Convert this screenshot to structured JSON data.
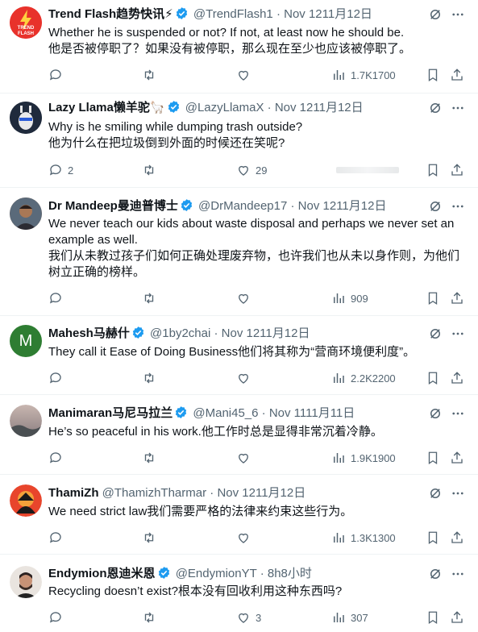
{
  "colors": {
    "text": "#0f1419",
    "muted": "#536471",
    "verified": "#1d9bf0",
    "border": "#eff3f4"
  },
  "tweets": [
    {
      "name": "Trend Flash趋势快讯⚡",
      "handle": "@TrendFlash1",
      "sep": "·",
      "time": "Nov 1211月12日",
      "lines": [
        "Whether he is suspended or not? If not, at least now he should be.",
        "他是否被停职了？如果没有被停职，那么现在至少也应该被停职了。"
      ],
      "replies": "",
      "retweets": "",
      "likes": "",
      "views": "1.7K1700",
      "avatar_label": "TREND FLASH"
    },
    {
      "name": "Lazy Llama懒羊驼🦙",
      "handle": "@LazyLlamaX",
      "sep": "·",
      "time": "Nov 1211月12日",
      "lines": [
        "Why is he smiling while dumping trash outside?",
        "他为什么在把垃圾倒到外面的时候还在笑呢?"
      ],
      "replies": "2",
      "retweets": "",
      "likes": "29",
      "views": ""
    },
    {
      "name": "Dr Mandeep曼迪普博士",
      "handle": "@DrMandeep17",
      "sep": "·",
      "time": "Nov 1211月12日",
      "lines": [
        "We never teach our kids about waste disposal and perhaps we never set an",
        "example as well.",
        "我们从未教过孩子们如何正确处理废弃物，也许我们也从未以身作则，为他们",
        "树立正确的榜样。"
      ],
      "replies": "",
      "retweets": "",
      "likes": "",
      "views": "909"
    },
    {
      "name": "Mahesh马赫什",
      "handle": "@1by2chai",
      "sep": "·",
      "time": "Nov 1211月12日",
      "lines": [
        "They call it Ease of Doing Business他们将其称为“营商环境便利度”。"
      ],
      "replies": "",
      "retweets": "",
      "likes": "",
      "views": "2.2K2200",
      "avatar_letter": "M"
    },
    {
      "name": "Manimaran马尼马拉兰",
      "handle": "@Mani45_6",
      "sep": "·",
      "time": "Nov 1111月11日",
      "lines": [
        "He’s so peaceful in his work.他工作时总是显得非常沉着冷静。"
      ],
      "replies": "",
      "retweets": "",
      "likes": "",
      "views": "1.9K1900"
    },
    {
      "name": "ThamiZh",
      "handle": "@ThamizhTharmar",
      "sep": "·",
      "time": "Nov 1211月12日",
      "lines": [
        "We need strict law我们需要严格的法律来约束这些行为。"
      ],
      "replies": "",
      "retweets": "",
      "likes": "",
      "views": "1.3K1300"
    },
    {
      "name": "Endymion恩迪米恩",
      "handle": "@EndymionYT",
      "sep": "·",
      "time": "8h8小时",
      "lines": [
        "Recycling doesn’t exist?根本没有回收利用这种东西吗?"
      ],
      "replies": "",
      "retweets": "",
      "likes": "3",
      "views": "307"
    }
  ]
}
